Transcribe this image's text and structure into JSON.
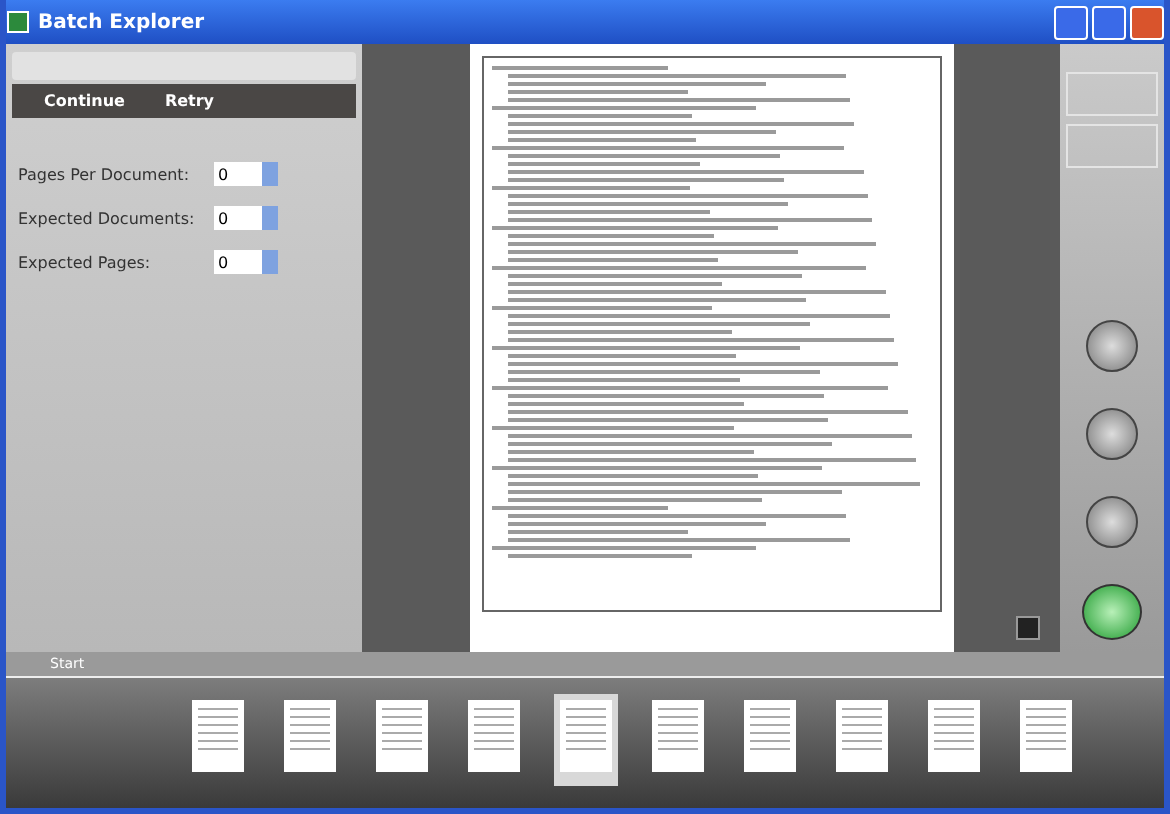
{
  "window": {
    "title": "Batch Explorer"
  },
  "toolbar": {
    "buttons": [
      "Continue",
      "Retry"
    ]
  },
  "settings": [
    {
      "label": "Pages Per Document:",
      "value": "0"
    },
    {
      "label": "Expected Documents:",
      "value": "0"
    },
    {
      "label": "Expected Pages:",
      "value": "0"
    }
  ],
  "filmstrip": {
    "label": "Start",
    "thumbnails": [
      {
        "selected": false
      },
      {
        "selected": false
      },
      {
        "selected": false
      },
      {
        "selected": false
      },
      {
        "selected": true
      },
      {
        "selected": false
      },
      {
        "selected": false
      },
      {
        "selected": false
      },
      {
        "selected": false
      },
      {
        "selected": false
      }
    ]
  }
}
